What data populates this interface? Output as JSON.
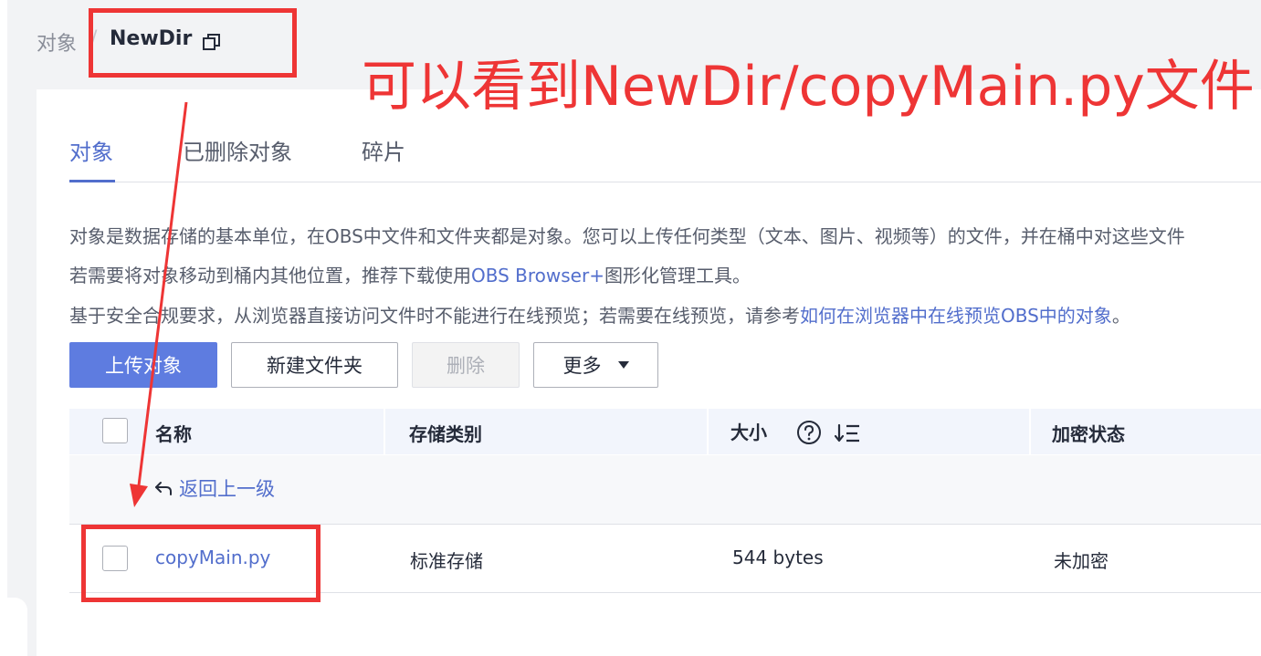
{
  "breadcrumb": {
    "parent": "对象",
    "separator": "/",
    "current": "NewDir"
  },
  "tabs": [
    {
      "label": "对象",
      "active": true
    },
    {
      "label": "已删除对象",
      "active": false
    },
    {
      "label": "碎片",
      "active": false
    }
  ],
  "description": {
    "line1": "对象是数据存储的基本单位，在OBS中文件和文件夹都是对象。您可以上传任何类型（文本、图片、视频等）的文件，并在桶中对这些文件",
    "line2_prefix": "若需要将对象移动到桶内其他位置，推荐下载使用",
    "line2_link": "OBS Browser+",
    "line2_suffix": "图形化管理工具。",
    "line3_prefix": "基于安全合规要求，从浏览器直接访问文件时不能进行在线预览；若需要在线预览，请参考",
    "line3_link": "如何在浏览器中在线预览OBS中的对象",
    "line3_suffix": "。"
  },
  "toolbar": {
    "upload": "上传对象",
    "new_folder": "新建文件夹",
    "delete": "删除",
    "more": "更多"
  },
  "table": {
    "columns": [
      "名称",
      "存储类别",
      "大小",
      "加密状态"
    ],
    "back_label": "返回上一级",
    "rows": [
      {
        "name": "copyMain.py",
        "storage_class": "标准存储",
        "size": "544 bytes",
        "encryption": "未加密"
      }
    ]
  },
  "annotation": {
    "text": "可以看到NewDir/copyMain.py文件",
    "color": "#ee3535"
  },
  "colors": {
    "accent": "#5e7ce0",
    "link": "#526ecc",
    "annotation_red": "#ee3535"
  }
}
